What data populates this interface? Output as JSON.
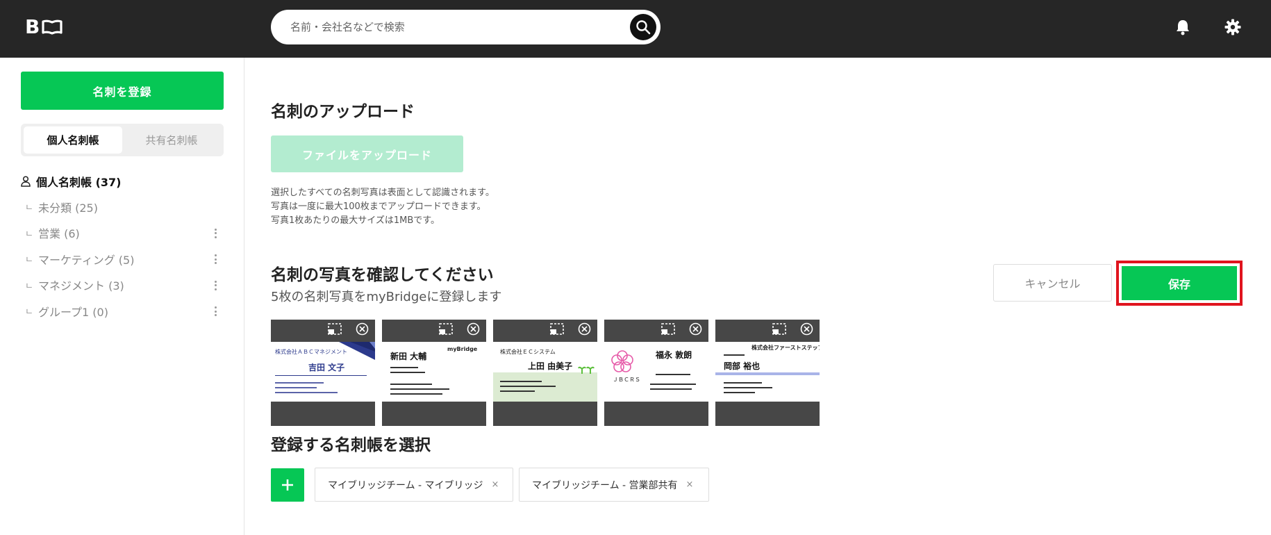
{
  "header": {
    "logo_letter": "B",
    "search_placeholder": "名前・会社名などで検索"
  },
  "sidebar": {
    "register_label": "名刺を登録",
    "tabs": [
      {
        "label": "個人名刺帳",
        "active": true
      },
      {
        "label": "共有名刺帳",
        "active": false
      }
    ],
    "root": {
      "label": "個人名刺帳 (37)"
    },
    "items": [
      {
        "branch": "ㄴ",
        "label": "未分類 (25)"
      },
      {
        "branch": "ㄴ",
        "label": "営業 (6)"
      },
      {
        "branch": "ㄴ",
        "label": "マーケティング (5)"
      },
      {
        "branch": "ㄴ",
        "label": "マネジメント (3)"
      },
      {
        "branch": "ㄴ",
        "label": "グループ1 (0)"
      }
    ]
  },
  "upload": {
    "title": "名刺のアップロード",
    "button_label": "ファイルをアップロード",
    "notes": [
      "選択したすべての名刺写真は表面として認識されます。",
      "写真は一度に最大100枚までアップロードできます。",
      "写真1枚あたりの最大サイズは1MBです。"
    ]
  },
  "confirm": {
    "title": "名刺の写真を確認してください",
    "subtitle": "5枚の名刺写真をmyBridgeに登録します",
    "cancel_label": "キャンセル",
    "save_label": "保存",
    "cards": [
      {
        "company": "株式会社ＡＢＣマネジメント",
        "name": "吉田 文子"
      },
      {
        "company": "myBridge",
        "name": "新田 大輔"
      },
      {
        "company": "株式会社ＥＣシステム",
        "name": "上田 由美子"
      },
      {
        "company": "ＪＢＣＲＳ",
        "name": "福永 敦朗"
      },
      {
        "company": "株式会社ファーストステップ",
        "name": "岡部 裕也"
      }
    ]
  },
  "select_book": {
    "title": "登録する名刺帳を選択",
    "add_label": "+",
    "chips": [
      {
        "label": "マイブリッジチーム - マイブリッジ",
        "remove": "×"
      },
      {
        "label": "マイブリッジチーム - 営業部共有",
        "remove": "×"
      }
    ]
  },
  "colors": {
    "header_bg": "#262626",
    "accent_green": "#06c755",
    "disabled_green": "#b3ecd0",
    "highlight_red": "#e0141e"
  }
}
